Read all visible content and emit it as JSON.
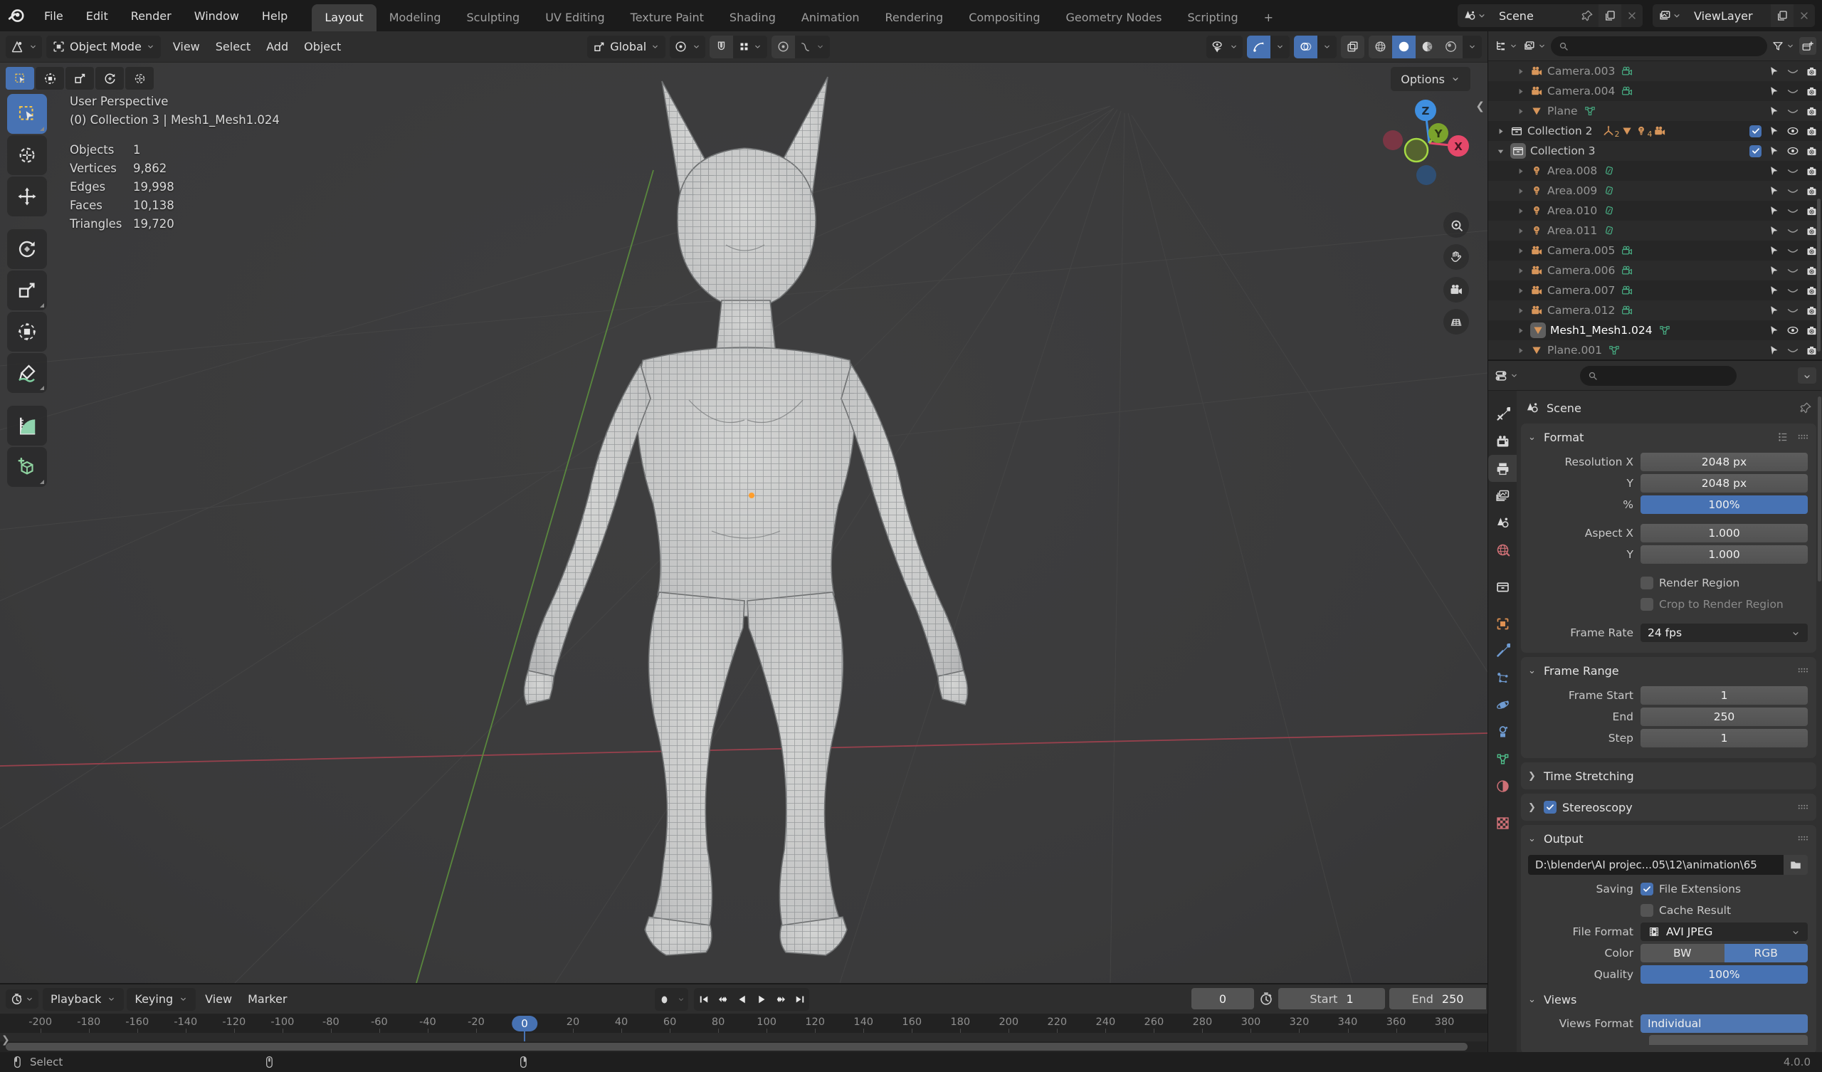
{
  "topbar": {
    "menus": [
      "File",
      "Edit",
      "Render",
      "Window",
      "Help"
    ],
    "workspaces": [
      "Layout",
      "Modeling",
      "Sculpting",
      "UV Editing",
      "Texture Paint",
      "Shading",
      "Animation",
      "Rendering",
      "Compositing",
      "Geometry Nodes",
      "Scripting"
    ],
    "active_workspace": "Layout",
    "add_workspace": "+",
    "scene_name": "Scene",
    "viewlayer_name": "ViewLayer"
  },
  "viewport": {
    "mode": "Object Mode",
    "menus": [
      "View",
      "Select",
      "Add",
      "Object"
    ],
    "orientation": "Global",
    "options_label": "Options",
    "stats": {
      "perspective": "User Perspective",
      "context": "(0) Collection 3 | Mesh1_Mesh1.024",
      "rows": [
        {
          "label": "Objects",
          "value": "1"
        },
        {
          "label": "Vertices",
          "value": "9,862"
        },
        {
          "label": "Edges",
          "value": "19,998"
        },
        {
          "label": "Faces",
          "value": "10,138"
        },
        {
          "label": "Triangles",
          "value": "19,720"
        }
      ]
    },
    "axis_labels": {
      "x": "X",
      "y": "Y",
      "z": "Z"
    },
    "toolshelf": [
      "select-box-tool",
      "cursor-tool",
      "move-tool",
      "rotate-tool",
      "scale-tool",
      "transform-tool",
      "annotate-tool",
      "measure-tool",
      "add-cube-tool"
    ]
  },
  "outliner": {
    "rows": [
      {
        "indent": 1,
        "icon": "camera-obj",
        "label": "Camera.003",
        "data_icon": "camera-data",
        "eye": "closed",
        "dim": true
      },
      {
        "indent": 1,
        "icon": "camera-obj",
        "label": "Camera.004",
        "data_icon": "camera-data",
        "eye": "closed",
        "dim": true
      },
      {
        "indent": 1,
        "icon": "mesh-obj",
        "label": "Plane",
        "data_icon": "mesh-data",
        "eye": "closed",
        "dim": true
      },
      {
        "indent": 0,
        "icon": "collection",
        "label": "Collection 2",
        "expand": "right",
        "checkbox": true,
        "eye": "open",
        "extras": [
          {
            "icon": "empty-axis",
            "count": "2"
          },
          {
            "icon": "mesh-obj"
          },
          {
            "icon": "light-obj",
            "count": "4"
          },
          {
            "icon": "camera-obj"
          }
        ]
      },
      {
        "indent": 0,
        "icon": "collection",
        "label": "Collection 3",
        "expand": "down",
        "checkbox": true,
        "eye": "open",
        "active": true
      },
      {
        "indent": 1,
        "icon": "light-obj",
        "label": "Area.008",
        "data_icon": "light-data",
        "eye": "closed",
        "dim": true
      },
      {
        "indent": 1,
        "icon": "light-obj",
        "label": "Area.009",
        "data_icon": "light-data",
        "eye": "closed",
        "dim": true
      },
      {
        "indent": 1,
        "icon": "light-obj",
        "label": "Area.010",
        "data_icon": "light-data",
        "eye": "closed",
        "dim": true
      },
      {
        "indent": 1,
        "icon": "light-obj",
        "label": "Area.011",
        "data_icon": "light-data",
        "eye": "closed",
        "dim": true
      },
      {
        "indent": 1,
        "icon": "camera-obj",
        "label": "Camera.005",
        "data_icon": "camera-data",
        "eye": "closed",
        "dim": true
      },
      {
        "indent": 1,
        "icon": "camera-obj",
        "label": "Camera.006",
        "data_icon": "camera-data",
        "eye": "closed",
        "dim": true
      },
      {
        "indent": 1,
        "icon": "camera-obj",
        "label": "Camera.007",
        "data_icon": "camera-data",
        "eye": "closed",
        "dim": true
      },
      {
        "indent": 1,
        "icon": "camera-obj",
        "label": "Camera.012",
        "data_icon": "camera-data",
        "eye": "closed",
        "dim": true
      },
      {
        "indent": 1,
        "icon": "mesh-obj",
        "label": "Mesh1_Mesh1.024",
        "data_icon": "mesh-data",
        "eye": "open",
        "selected": true
      },
      {
        "indent": 1,
        "icon": "mesh-obj",
        "label": "Plane.001",
        "data_icon": "mesh-data",
        "eye": "closed",
        "dim": true
      }
    ]
  },
  "properties": {
    "breadcrumb": "Scene",
    "active_tab": "output",
    "tabs": [
      {
        "name": "tool",
        "color": "#d8d8d8"
      },
      {
        "name": "render",
        "color": "#d8d8d8"
      },
      {
        "name": "output",
        "color": "#d8d8d8"
      },
      {
        "name": "view-layer",
        "color": "#d8d8d8",
        "grp": false
      },
      {
        "name": "scene",
        "color": "#d8d8d8"
      },
      {
        "name": "world",
        "color": "#cf7076"
      },
      {
        "name": "collection",
        "color": "#d8d8d8",
        "grp": true
      },
      {
        "name": "object",
        "color": "#de9152",
        "grp": true
      },
      {
        "name": "modifiers",
        "color": "#6f9bd1"
      },
      {
        "name": "particles",
        "color": "#6f9bd1"
      },
      {
        "name": "physics",
        "color": "#6f9bd1"
      },
      {
        "name": "constraints",
        "color": "#6f9bd1"
      },
      {
        "name": "object-data",
        "color": "#4fbf8b"
      },
      {
        "name": "material",
        "color": "#cf7076"
      },
      {
        "name": "texture",
        "color": "#cf7076",
        "grp": true
      }
    ],
    "panels": [
      {
        "name": "format",
        "title": "Format",
        "header_icons": [
          "presets",
          "grip"
        ],
        "fields": [
          {
            "type": "value",
            "label": "Resolution X",
            "value": "2048 px"
          },
          {
            "type": "value",
            "label": "Y",
            "value": "2048 px"
          },
          {
            "type": "slider",
            "label": "%",
            "value": "100%"
          },
          {
            "type": "gap"
          },
          {
            "type": "value",
            "label": "Aspect X",
            "value": "1.000"
          },
          {
            "type": "value",
            "label": "Y",
            "value": "1.000"
          },
          {
            "type": "gap"
          },
          {
            "type": "check",
            "label": "Render Region",
            "checked": false
          },
          {
            "type": "check",
            "label": "Crop to Render Region",
            "checked": false,
            "dim": true
          },
          {
            "type": "gap"
          },
          {
            "type": "dropdown",
            "label": "Frame Rate",
            "value": "24 fps"
          }
        ]
      },
      {
        "name": "frame-range",
        "title": "Frame Range",
        "header_icons": [
          "grip"
        ],
        "fields": [
          {
            "type": "value",
            "label": "Frame Start",
            "value": "1"
          },
          {
            "type": "value",
            "label": "End",
            "value": "250"
          },
          {
            "type": "value",
            "label": "Step",
            "value": "1"
          }
        ]
      },
      {
        "name": "time-stretching",
        "title": "Time Stretching",
        "collapsed": true
      },
      {
        "name": "stereoscopy",
        "title": "Stereoscopy",
        "collapsed": true,
        "checkbox": true,
        "header_icons": [
          "grip"
        ]
      },
      {
        "name": "output",
        "title": "Output",
        "header_icons": [
          "grip"
        ],
        "fields": [
          {
            "type": "path",
            "value": "D:\\blender\\AI projec...05\\12\\animation\\65"
          },
          {
            "type": "check",
            "label": "File Extensions",
            "rowlabel": "Saving",
            "checked": true
          },
          {
            "type": "check",
            "label": "Cache Result",
            "checked": false
          },
          {
            "type": "dropdown",
            "label": "File Format",
            "value": "AVI JPEG",
            "icon": "film"
          },
          {
            "type": "segmented",
            "label": "Color",
            "options": [
              "BW",
              "RGB"
            ],
            "active": 1
          },
          {
            "type": "slider",
            "label": "Quality",
            "value": "100%"
          },
          {
            "type": "subheader",
            "title": "Views"
          },
          {
            "type": "button-blue",
            "label": "Views Format",
            "value": "Individual"
          }
        ]
      }
    ]
  },
  "timeline": {
    "menus_dropdown": [
      "Playback",
      "Keying"
    ],
    "menus_plain": [
      "View",
      "Marker"
    ],
    "ticks": [
      -200,
      -180,
      -160,
      -140,
      -120,
      -100,
      -80,
      -60,
      -40,
      -20,
      0,
      20,
      40,
      60,
      80,
      100,
      120,
      140,
      160,
      180,
      200,
      220,
      240,
      260,
      280,
      300,
      320,
      340,
      360,
      380
    ],
    "current_frame": "0",
    "start_label": "Start",
    "start_value": "1",
    "end_label": "End",
    "end_value": "250"
  },
  "statusbar": {
    "left_hint": "Select",
    "version": "4.0.0"
  },
  "colors": {
    "accent_blue": "#4772b3",
    "object_orange": "#d8965a",
    "data_green": "#47ab82",
    "axis_x_red": "#e5486a",
    "axis_y_green": "#9bc23f",
    "axis_z_blue": "#3f8fe0"
  }
}
